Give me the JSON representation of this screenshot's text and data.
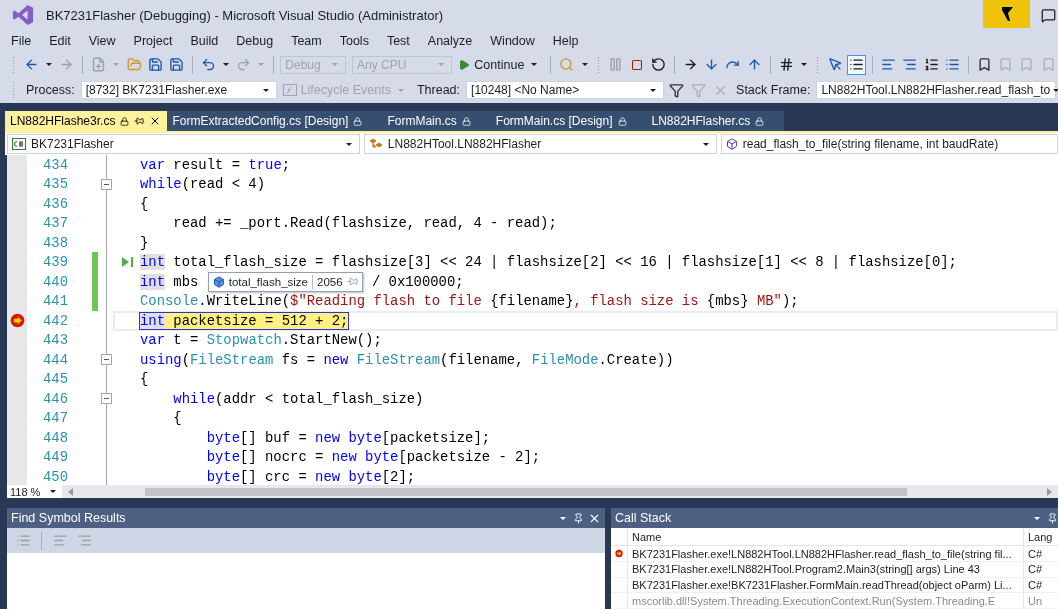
{
  "window": {
    "title": "BK7231Flasher (Debugging) - Microsoft Visual Studio  (Administrator)"
  },
  "menu": [
    "File",
    "Edit",
    "View",
    "Project",
    "Build",
    "Debug",
    "Team",
    "Tools",
    "Test",
    "Analyze",
    "Window",
    "Help"
  ],
  "toolbar": {
    "configuration": {
      "value": "Debug",
      "disabled": true
    },
    "platform": {
      "value": "Any CPU",
      "disabled": true
    },
    "continue_button": "Continue"
  },
  "debug_location": {
    "process_label": "Process:",
    "process": "[8732] BK7231Flasher.exe",
    "lifecycle": {
      "label": "Lifecycle Events",
      "disabled": true
    },
    "thread_label": "Thread:",
    "thread": "[10248] <No Name>",
    "stack_frame_label": "Stack Frame:",
    "stack_frame": "LN882HTool.LN882HFlasher.read_flash_to"
  },
  "tabs": [
    {
      "label": "LN882HFlashe3r.cs",
      "selected": true,
      "locked": true
    },
    {
      "label": "FormExtractedConfig.cs [Design]",
      "selected": false,
      "locked": true
    },
    {
      "label": "FormMain.cs",
      "selected": false,
      "locked": true
    },
    {
      "label": "FormMain.cs [Design]",
      "selected": false,
      "locked": true
    },
    {
      "label": "LN882HFlasher.cs",
      "selected": false,
      "locked": true
    }
  ],
  "nav_bar": {
    "project": "BK7231Flasher",
    "type": "LN882HTool.LN882HFlasher",
    "member": "read_flash_to_file(string filename, int baudRate)"
  },
  "editor": {
    "zoom": "118 %",
    "lines": [
      {
        "number": "434",
        "collapsible": false,
        "changed": false,
        "current": false,
        "tokens": [
          {
            "kind": "kw",
            "text": "var"
          },
          {
            "kind": "plain",
            "text": " result = "
          },
          {
            "kind": "kw",
            "text": "true"
          },
          {
            "kind": "plain",
            "text": ";"
          }
        ]
      },
      {
        "number": "435",
        "collapsible": true,
        "changed": false,
        "current": false,
        "tokens": [
          {
            "kind": "kw",
            "text": "while"
          },
          {
            "kind": "plain",
            "text": "(read < 4)"
          }
        ]
      },
      {
        "number": "436",
        "collapsible": false,
        "changed": false,
        "current": false,
        "tokens": [
          {
            "kind": "plain",
            "text": "{"
          }
        ]
      },
      {
        "number": "437",
        "collapsible": false,
        "changed": false,
        "current": false,
        "tokens": [
          {
            "kind": "plain",
            "text": "    read += _port.Read(flashsize, read, 4 - read);"
          }
        ]
      },
      {
        "number": "438",
        "collapsible": false,
        "changed": false,
        "current": false,
        "tokens": [
          {
            "kind": "plain",
            "text": "}"
          }
        ]
      },
      {
        "number": "439",
        "collapsible": false,
        "changed": true,
        "current": false,
        "marker": {
          "kind": "run-to-click"
        },
        "tokens": [
          {
            "kind": "ref",
            "text": "int"
          },
          {
            "kind": "plain",
            "text": " total_flash_size = flashsize[3] << 24 | flashsize[2] << 16 | flashsize[1] << 8 | flashsize[0];"
          }
        ]
      },
      {
        "number": "440",
        "collapsible": false,
        "changed": true,
        "current": false,
        "tokens": [
          {
            "kind": "ref",
            "text": "int"
          },
          {
            "kind": "plain",
            "text": " mbs "
          },
          {
            "kind": "datatip",
            "name": "total_flash_size",
            "value": "2056"
          },
          {
            "kind": "plain",
            "text": " / 0x100000;"
          }
        ]
      },
      {
        "number": "441",
        "collapsible": false,
        "changed": true,
        "current": false,
        "tokens": [
          {
            "kind": "type",
            "text": "Console"
          },
          {
            "kind": "plain",
            "text": ".WriteLine("
          },
          {
            "kind": "str",
            "text": "$\"Reading flash to file "
          },
          {
            "kind": "plain",
            "text": "{filename}"
          },
          {
            "kind": "str",
            "text": ", flash size is "
          },
          {
            "kind": "plain",
            "text": "{mbs}"
          },
          {
            "kind": "str",
            "text": " MB\""
          },
          {
            "kind": "plain",
            "text": ");"
          }
        ]
      },
      {
        "number": "442",
        "collapsible": false,
        "changed": false,
        "current": true,
        "marker": {
          "kind": "instruction-pointer"
        },
        "tokens": [
          {
            "kind": "ref",
            "text": "int"
          },
          {
            "kind": "plain",
            "text": " packetsize = 512 + 2;"
          }
        ]
      },
      {
        "number": "443",
        "collapsible": false,
        "changed": false,
        "current": false,
        "tokens": [
          {
            "kind": "kw",
            "text": "var"
          },
          {
            "kind": "plain",
            "text": " t = "
          },
          {
            "kind": "type",
            "text": "Stopwatch"
          },
          {
            "kind": "plain",
            "text": ".StartNew();"
          }
        ]
      },
      {
        "number": "444",
        "collapsible": true,
        "changed": false,
        "current": false,
        "tokens": [
          {
            "kind": "kw",
            "text": "using"
          },
          {
            "kind": "plain",
            "text": "("
          },
          {
            "kind": "type",
            "text": "FileStream"
          },
          {
            "kind": "plain",
            "text": " fs = "
          },
          {
            "kind": "kw",
            "text": "new "
          },
          {
            "kind": "type",
            "text": "FileStream"
          },
          {
            "kind": "plain",
            "text": "(filename, "
          },
          {
            "kind": "type",
            "text": "FileMode"
          },
          {
            "kind": "plain",
            "text": ".Create))"
          }
        ]
      },
      {
        "number": "445",
        "collapsible": false,
        "changed": false,
        "current": false,
        "tokens": [
          {
            "kind": "plain",
            "text": "{"
          }
        ]
      },
      {
        "number": "446",
        "collapsible": true,
        "changed": false,
        "current": false,
        "tokens": [
          {
            "kind": "kw",
            "text": "    while"
          },
          {
            "kind": "plain",
            "text": "(addr < total_flash_size)"
          }
        ]
      },
      {
        "number": "447",
        "collapsible": false,
        "changed": false,
        "current": false,
        "tokens": [
          {
            "kind": "plain",
            "text": "    {"
          }
        ]
      },
      {
        "number": "448",
        "collapsible": false,
        "changed": false,
        "current": false,
        "tokens": [
          {
            "kind": "kw",
            "text": "        byte"
          },
          {
            "kind": "plain",
            "text": "[] buf = "
          },
          {
            "kind": "kw",
            "text": "new byte"
          },
          {
            "kind": "plain",
            "text": "[packetsize];"
          }
        ]
      },
      {
        "number": "449",
        "collapsible": false,
        "changed": false,
        "current": false,
        "tokens": [
          {
            "kind": "kw",
            "text": "        byte"
          },
          {
            "kind": "plain",
            "text": "[] nocrc = "
          },
          {
            "kind": "kw",
            "text": "new byte"
          },
          {
            "kind": "plain",
            "text": "[packetsize - 2];"
          }
        ]
      },
      {
        "number": "450",
        "collapsible": false,
        "changed": false,
        "current": false,
        "tokens": [
          {
            "kind": "kw",
            "text": "        byte"
          },
          {
            "kind": "plain",
            "text": "[] crc = "
          },
          {
            "kind": "kw",
            "text": "new byte"
          },
          {
            "kind": "plain",
            "text": "[2];"
          }
        ]
      }
    ]
  },
  "find_symbol_panel": {
    "title": "Find Symbol Results"
  },
  "call_stack_panel": {
    "title": "Call Stack",
    "columns": [
      "Name",
      "Lang"
    ],
    "rows": [
      {
        "name": "BK7231Flasher.exe!LN882HTool.LN882HFlasher.read_flash_to_file(string fil...",
        "lang": "C#",
        "current": true,
        "dimmed": false
      },
      {
        "name": "BK7231Flasher.exe!LN882HTool.Program2.Main3(string[] args) Line 43",
        "lang": "C#",
        "current": false,
        "dimmed": false
      },
      {
        "name": "BK7231Flasher.exe!BK7231Flasher.FormMain.readThread(object oParm) Li...",
        "lang": "C#",
        "current": false,
        "dimmed": false
      },
      {
        "name": "mscorlib.dll!System.Threading.ExecutionContext.Run(System.Threading.E",
        "lang": "Un",
        "current": false,
        "dimmed": true
      }
    ]
  }
}
